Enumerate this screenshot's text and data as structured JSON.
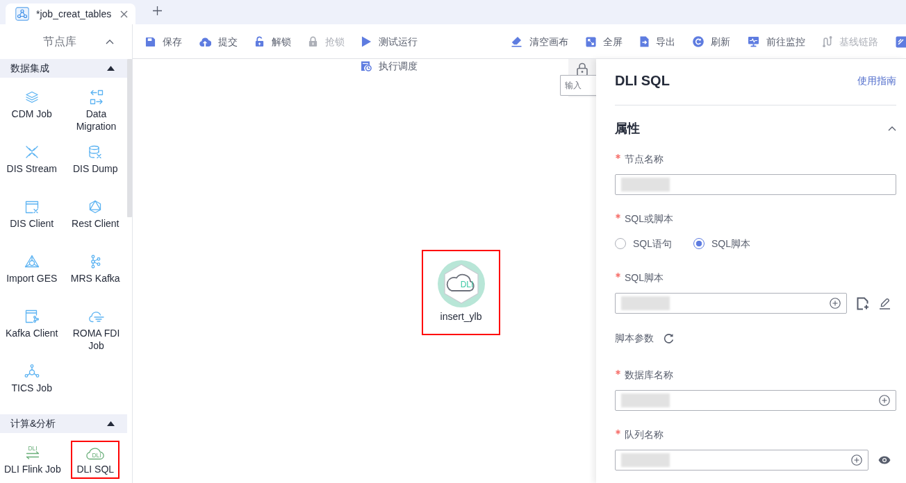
{
  "tabs": [
    {
      "title": "*job_creat_tables",
      "selected": true
    }
  ],
  "node_library": {
    "title": "节点库",
    "expanded": true,
    "groups": [
      {
        "title": "数据集成",
        "expanded": true,
        "items": [
          {
            "label": "CDM Job",
            "kind": "layers",
            "highlighted": false
          },
          {
            "label": "Data Migration",
            "kind": "migration",
            "highlighted": false
          },
          {
            "label": "DIS Stream",
            "kind": "stream",
            "highlighted": false
          },
          {
            "label": "DIS Dump",
            "kind": "dump",
            "highlighted": false
          },
          {
            "label": "DIS Client",
            "kind": "client",
            "highlighted": false
          },
          {
            "label": "Rest Client",
            "kind": "rest",
            "highlighted": false
          },
          {
            "label": "Import GES",
            "kind": "ges",
            "highlighted": false
          },
          {
            "label": "MRS Kafka",
            "kind": "kafka",
            "highlighted": false
          },
          {
            "label": "Kafka Client",
            "kind": "kafka-client",
            "highlighted": false
          },
          {
            "label": "ROMA FDI Job",
            "kind": "roma",
            "highlighted": false
          },
          {
            "label": "TICS Job",
            "kind": "tics",
            "highlighted": false
          }
        ]
      },
      {
        "title": "计算&分析",
        "expanded": true,
        "items": [
          {
            "label": "DLI Flink Job",
            "kind": "flink",
            "icon_text": "DLI",
            "highlighted": false
          },
          {
            "label": "DLI SQL",
            "kind": "dli-sql",
            "icon_text": "DLI",
            "highlighted": true
          }
        ]
      }
    ]
  },
  "toolbar": {
    "left": [
      {
        "label": "保存",
        "kind": "save",
        "disabled": false
      },
      {
        "label": "提交",
        "kind": "submit",
        "disabled": false
      },
      {
        "label": "解锁",
        "kind": "unlock",
        "disabled": false
      },
      {
        "label": "抢锁",
        "kind": "lock",
        "disabled": true
      },
      {
        "label": "测试运行",
        "kind": "run",
        "disabled": false
      },
      {
        "label": "执行调度",
        "kind": "schedule",
        "disabled": false
      }
    ],
    "right": [
      {
        "label": "清空画布",
        "kind": "clear",
        "disabled": false
      },
      {
        "label": "全屏",
        "kind": "fullscreen",
        "disabled": false
      },
      {
        "label": "导出",
        "kind": "export",
        "disabled": false
      },
      {
        "label": "刷新",
        "kind": "refresh",
        "disabled": false
      },
      {
        "label": "前往监控",
        "kind": "monitor",
        "disabled": false
      },
      {
        "label": "基线链路",
        "kind": "baseline",
        "disabled": true
      },
      {
        "kind": "form",
        "disabled": false
      }
    ]
  },
  "canvas": {
    "nodes": [
      {
        "label": "insert_ylb",
        "badge": "DLI",
        "highlighted": true
      }
    ],
    "search": {
      "placeholder": "输入"
    }
  },
  "properties": {
    "title": "DLI SQL",
    "guide_link": "使用指南",
    "section": {
      "title": "属性",
      "expanded": true,
      "fields": [
        {
          "kind": "input",
          "label": "节点名称",
          "required": true,
          "redacted": true
        },
        {
          "kind": "radio",
          "label": "SQL或脚本",
          "required": true,
          "options": [
            {
              "label": "SQL语句",
              "selected": false
            },
            {
              "label": "SQL脚本",
              "selected": true
            }
          ]
        },
        {
          "kind": "picker",
          "label": "SQL脚本",
          "required": true,
          "redacted": true,
          "actions": [
            {
              "kind": "new-file"
            },
            {
              "kind": "edit"
            }
          ]
        },
        {
          "kind": "params",
          "label": "脚本参数",
          "required": false
        },
        {
          "kind": "picker",
          "label": "数据库名称",
          "required": true,
          "redacted": true
        },
        {
          "kind": "picker",
          "label": "队列名称",
          "required": true,
          "redacted": true,
          "actions": [
            {
              "kind": "view"
            }
          ]
        }
      ]
    }
  }
}
